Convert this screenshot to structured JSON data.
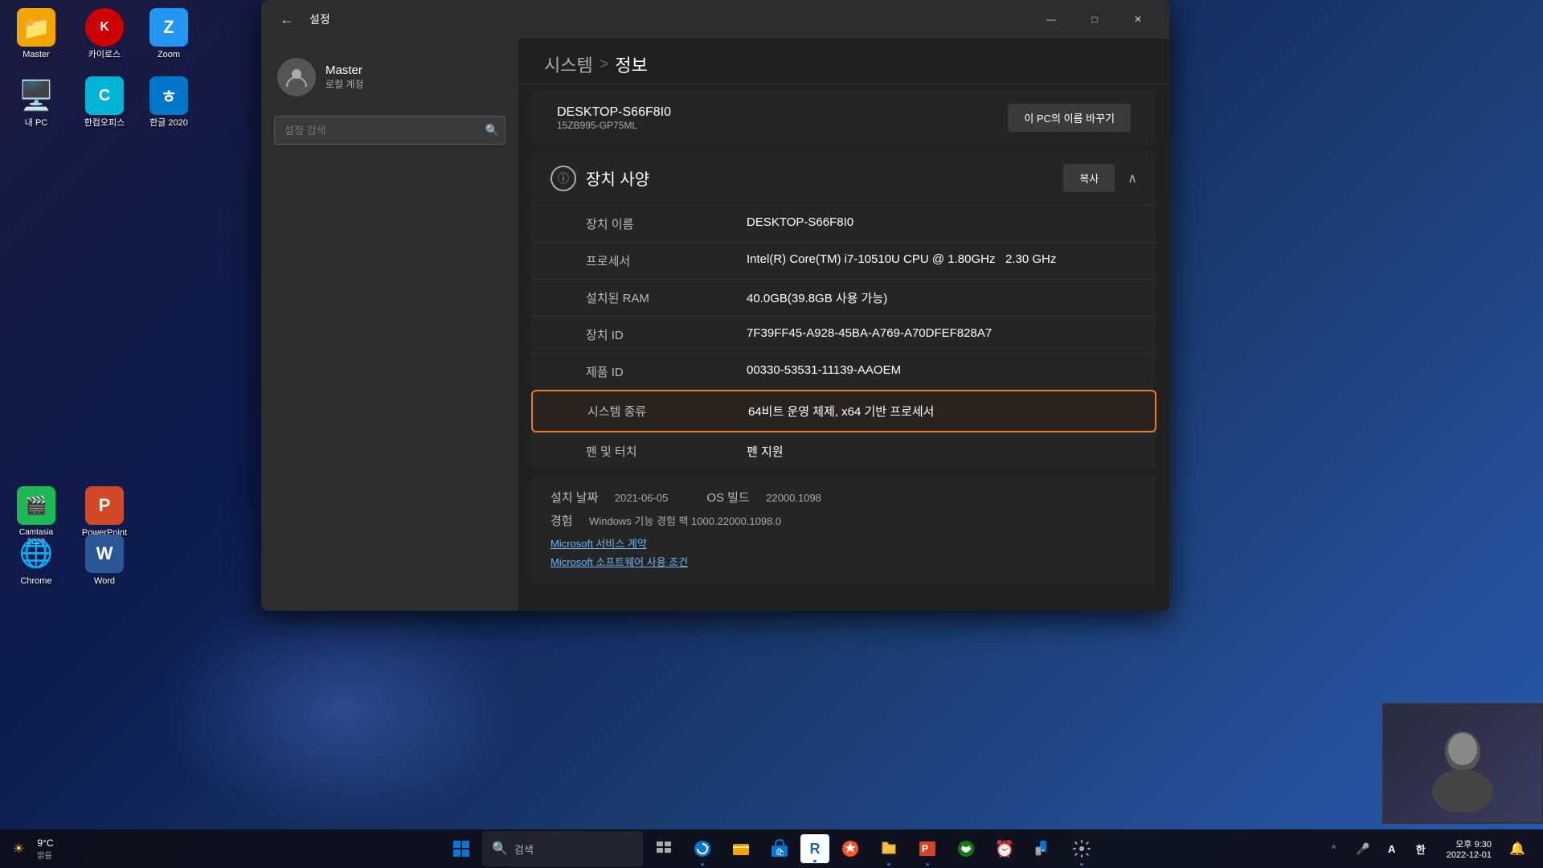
{
  "desktop": {
    "icons": [
      {
        "id": "master",
        "label": "Master",
        "emoji": "📁",
        "bg": "#f0a500"
      },
      {
        "id": "kairos",
        "label": "카이로스",
        "emoji": "🔴",
        "bg": "#e63946"
      },
      {
        "id": "zoom",
        "label": "Zoom",
        "emoji": "📹",
        "bg": "#2196F3"
      },
      {
        "id": "my-pc",
        "label": "내 PC",
        "emoji": "🖥️",
        "bg": "#0078d4"
      },
      {
        "id": "hancom-office",
        "label": "한컴오피스",
        "emoji": "📄",
        "bg": "#00b4d8"
      },
      {
        "id": "hangul-2020",
        "label": "한글 2020",
        "emoji": "ㅎ",
        "bg": "#0077c8"
      },
      {
        "id": "camtasia",
        "label": "Camtasia 2020",
        "emoji": "🎬",
        "bg": "#1db954"
      },
      {
        "id": "powerpoint",
        "label": "PowerPoint",
        "emoji": "📊",
        "bg": "#d24726"
      },
      {
        "id": "chrome",
        "label": "Chrome",
        "emoji": "🌐",
        "bg": "#4285F4"
      },
      {
        "id": "word",
        "label": "Word",
        "emoji": "W",
        "bg": "#2b5797"
      }
    ]
  },
  "window": {
    "title": "설정",
    "back_label": "←",
    "minimize": "—",
    "maximize": "□",
    "close": "✕"
  },
  "user": {
    "name": "Master",
    "type": "로컬 계정"
  },
  "search": {
    "placeholder": "설정 검색"
  },
  "breadcrumb": {
    "parent": "시스템",
    "separator": ">",
    "current": "정보"
  },
  "pc_card": {
    "name": "DESKTOP-S66F8I0",
    "model": "15ZB995-GP75ML",
    "rename_label": "이 PC의 이름 바꾸기"
  },
  "specs_section": {
    "title": "장치 사양",
    "copy_label": "복사",
    "rows": [
      {
        "label": "장치 이름",
        "value": "DESKTOP-S66F8I0"
      },
      {
        "label": "프로세서",
        "value": "Intel(R) Core(TM) i7-10510U CPU @ 1.80GHz   2.30 GHz"
      },
      {
        "label": "설치된 RAM",
        "value": "40.0GB(39.8GB 사용 가능)"
      },
      {
        "label": "장치 ID",
        "value": "7F39FF45-A928-45BA-A769-A70DFEF828A7"
      },
      {
        "label": "제품 ID",
        "value": "00330-53531-11139-AAOEM"
      },
      {
        "label": "시스템 종류",
        "value": "64비트 운영 체제, x64 기반 프로세서",
        "highlighted": true
      },
      {
        "label": "펜 및 터치",
        "value": "펜 지원"
      }
    ]
  },
  "windows_section": {
    "install_date_label": "설치 날짜",
    "install_date_value": "2021-06-05",
    "os_build_label": "OS 빌드",
    "os_build_value": "22000.1098",
    "experience_label": "경험",
    "experience_value": "Windows 기능 경험 팩 1000.22000.1098.0",
    "link1": "Microsoft 서비스 계약",
    "link2": "Microsoft 소프트웨어 사용 조건"
  },
  "taskbar": {
    "weather_temp": "9°C",
    "weather_desc": "맑음",
    "search_placeholder": "검색",
    "apps": [
      {
        "id": "windows-btn",
        "emoji": "⊞",
        "label": "시작"
      },
      {
        "id": "search-btn",
        "emoji": "🔍",
        "label": "검색"
      },
      {
        "id": "task-view",
        "emoji": "▣",
        "label": "작업 보기"
      },
      {
        "id": "edge",
        "emoji": "🌐",
        "label": "Edge"
      },
      {
        "id": "folder",
        "emoji": "📁",
        "label": "파일 탐색기"
      },
      {
        "id": "store",
        "emoji": "🛍",
        "label": "스토어"
      },
      {
        "id": "r-icon",
        "emoji": "R",
        "label": "R"
      },
      {
        "id": "edge2",
        "emoji": "◉",
        "label": "Edge"
      },
      {
        "id": "files",
        "emoji": "📂",
        "label": "파일"
      },
      {
        "id": "pptx",
        "emoji": "📊",
        "label": "PowerPoint"
      },
      {
        "id": "xbox",
        "emoji": "🎮",
        "label": "Xbox"
      },
      {
        "id": "alarm",
        "emoji": "⏰",
        "label": "알람"
      },
      {
        "id": "phone",
        "emoji": "📱",
        "label": "휴대폰"
      },
      {
        "id": "settings",
        "emoji": "⚙",
        "label": "설정",
        "active": true
      }
    ],
    "tray": {
      "chevron": "^",
      "mic": "🎤",
      "keyboard_icon": "A",
      "korean": "한",
      "notifications": "🔔"
    }
  }
}
